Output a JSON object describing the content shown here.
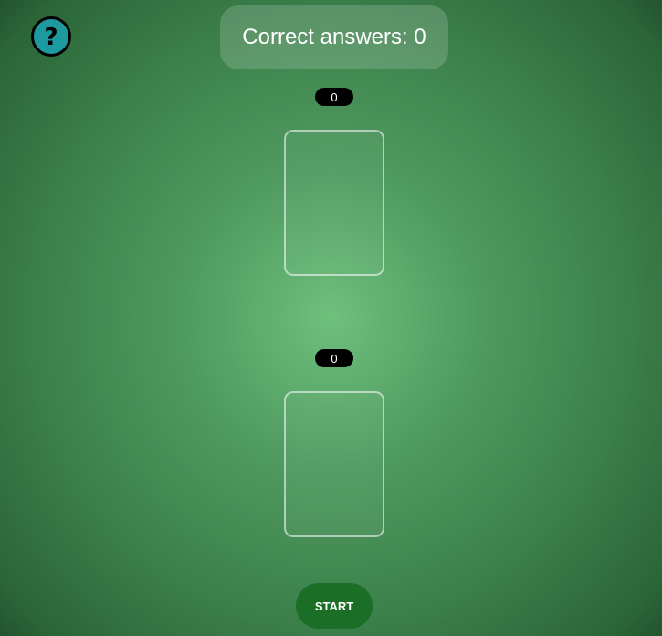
{
  "help": {
    "icon": "question-mark-icon",
    "glyph": "?"
  },
  "score": {
    "label": "Correct answers: 0"
  },
  "deck_top": {
    "count": "0"
  },
  "deck_bottom": {
    "count": "0"
  },
  "controls": {
    "start_label": "START"
  },
  "colors": {
    "table_green": "#4f9a60",
    "help_teal": "#1d9aa0",
    "start_green": "#1a6e25"
  }
}
